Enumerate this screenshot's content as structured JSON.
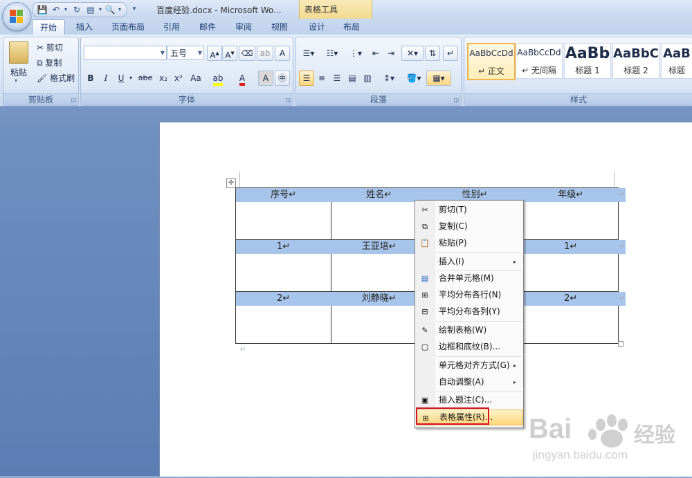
{
  "window": {
    "title": "百度经验.docx - Microsoft Wo...",
    "context_tab_group": "表格工具"
  },
  "tabs": [
    {
      "label": "开始",
      "active": true
    },
    {
      "label": "插入"
    },
    {
      "label": "页面布局"
    },
    {
      "label": "引用"
    },
    {
      "label": "邮件"
    },
    {
      "label": "审阅"
    },
    {
      "label": "视图"
    },
    {
      "label": "设计"
    },
    {
      "label": "布局"
    }
  ],
  "ribbon": {
    "clipboard": {
      "group_label": "剪贴板",
      "paste": "粘贴",
      "cut": "剪切",
      "copy": "复制",
      "format_painter": "格式刷"
    },
    "font": {
      "group_label": "字体",
      "font_name": "",
      "font_size": "五号",
      "bold": "B",
      "italic": "I",
      "underline": "U",
      "strike": "abe",
      "sub": "x₂",
      "sup": "x²",
      "case": "Aa",
      "char_border": "A",
      "phonetic": "A"
    },
    "paragraph": {
      "group_label": "段落"
    },
    "styles": {
      "group_label": "样式",
      "tiles": [
        {
          "preview": "AaBbCcDd",
          "name": "↵ 正文",
          "selected": true
        },
        {
          "preview": "AaBbCcDd",
          "name": "↵ 无间隔"
        },
        {
          "preview": "AaBb",
          "name": "标题 1"
        },
        {
          "preview": "AaBbC",
          "name": "标题 2"
        },
        {
          "preview": "AaB",
          "name": "标题"
        }
      ]
    }
  },
  "table": {
    "header": [
      "序号↵",
      "姓名↵",
      "性别↵",
      "年级↵"
    ],
    "rows": [
      [
        "1↵",
        "王亚培↵",
        "",
        "1↵"
      ],
      [
        "2↵",
        "刘静晓↵",
        "",
        "2↵"
      ]
    ],
    "row_end_mark": "↵",
    "para_mark": "↵"
  },
  "context_menu": {
    "items": [
      {
        "label": "剪切(T)",
        "icon": "scissors-icon"
      },
      {
        "label": "复制(C)",
        "icon": "copy-icon"
      },
      {
        "label": "粘贴(P)",
        "icon": "paste-icon"
      },
      {
        "label": "插入(I)",
        "submenu": true
      },
      {
        "label": "合并单元格(M)",
        "icon": "merge-cells-icon"
      },
      {
        "label": "平均分布各行(N)",
        "icon": "distribute-rows-icon"
      },
      {
        "label": "平均分布各列(Y)",
        "icon": "distribute-columns-icon"
      },
      {
        "label": "绘制表格(W)",
        "icon": "draw-table-icon"
      },
      {
        "label": "边框和底纹(B)...",
        "icon": "borders-icon"
      },
      {
        "label": "单元格对齐方式(G)",
        "submenu": true
      },
      {
        "label": "自动调整(A)",
        "submenu": true
      },
      {
        "label": "插入题注(C)...",
        "icon": "caption-icon"
      },
      {
        "label": "表格属性(R)...",
        "icon": "table-properties-icon",
        "highlighted": true
      }
    ],
    "submenu_arrow": "▸"
  },
  "watermark": {
    "brand": "Bai",
    "brand2": "经验",
    "domain": "jingyan.baidu.com"
  },
  "colors": {
    "highlight_row": "#a7c4ea",
    "annotation_box": "#d2112a",
    "menu_hover": "#ffd67a"
  }
}
